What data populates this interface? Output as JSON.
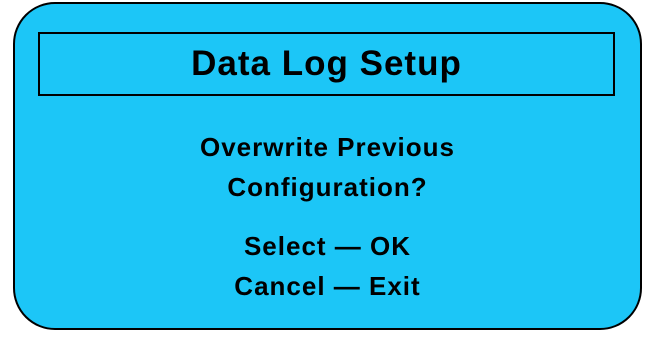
{
  "screen": {
    "title": "Data Log Setup",
    "prompt_line1": "Overwrite Previous",
    "prompt_line2": "Configuration?",
    "option_select": "Select — OK",
    "option_cancel": "Cancel — Exit",
    "colors": {
      "background": "#1cc6f7",
      "text": "#000000",
      "border": "#000000"
    }
  }
}
